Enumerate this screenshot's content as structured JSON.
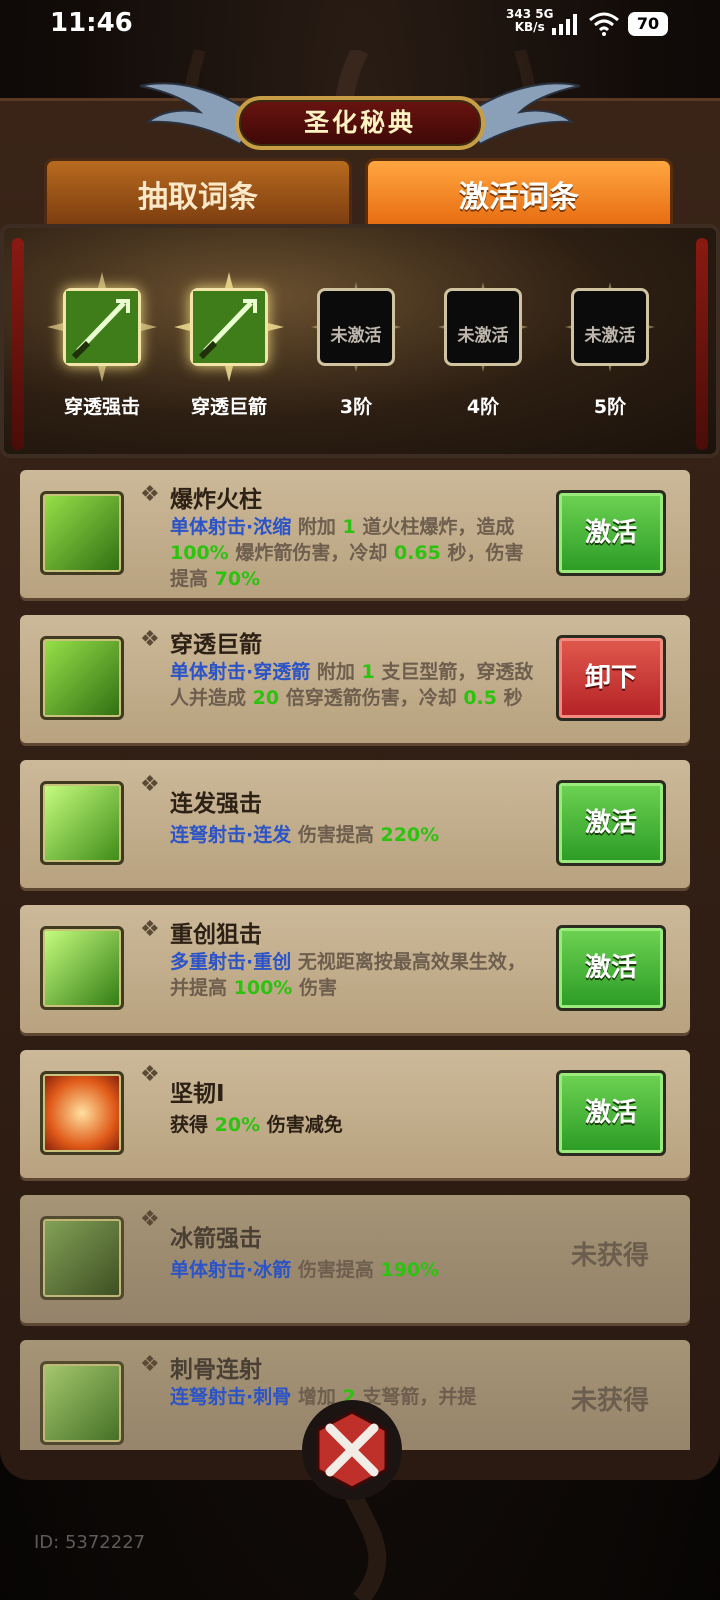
{
  "status_bar": {
    "time": "11:46",
    "net_speed": "343",
    "net_speed_unit": "KB/s",
    "net_type": "5G",
    "battery": "70"
  },
  "header": {
    "title": "圣化秘典"
  },
  "tabs": [
    {
      "label": "抽取词条",
      "active": false
    },
    {
      "label": "激活词条",
      "active": true
    }
  ],
  "slots": [
    {
      "name": "穿透强击",
      "active": true
    },
    {
      "name": "穿透巨箭",
      "active": true
    },
    {
      "name": "3阶",
      "active": false,
      "locked_text": "未激活"
    },
    {
      "name": "4阶",
      "active": false,
      "locked_text": "未激活"
    },
    {
      "name": "5阶",
      "active": false,
      "locked_text": "未激活"
    }
  ],
  "entries": [
    {
      "title": "爆炸火柱",
      "tag": "单体射击·浓缩",
      "desc_parts": [
        "附加 ",
        "1",
        " 道火柱爆炸，造成 ",
        "100%",
        " 爆炸箭伤害，冷却 ",
        "0.65",
        " 秒，伤害提高 ",
        "70%"
      ],
      "button": "激活",
      "button_type": "activate"
    },
    {
      "title": "穿透巨箭",
      "tag": "单体射击·穿透箭",
      "desc_parts": [
        "附加 ",
        "1",
        " 支巨型箭，穿透敌人并造成 ",
        "20",
        " 倍穿透箭伤害，冷却 ",
        "0.5",
        " 秒"
      ],
      "button": "卸下",
      "button_type": "unequip"
    },
    {
      "title": "连发强击",
      "tag": "连弩射击·连发",
      "desc_parts": [
        "伤害提高 ",
        "220%"
      ],
      "button": "激活",
      "button_type": "activate"
    },
    {
      "title": "重创狙击",
      "tag": "多重射击·重创",
      "desc_parts": [
        "无视距离按最高效果生效，并提高 ",
        "100%",
        " 伤害"
      ],
      "button": "激活",
      "button_type": "activate"
    },
    {
      "title": "坚韧Ⅰ",
      "tag": "",
      "desc_parts": [
        "获得 ",
        "20%",
        " 伤害减免"
      ],
      "button": "激活",
      "button_type": "activate"
    },
    {
      "title": "冰箭强击",
      "tag": "单体射击·冰箭",
      "desc_parts": [
        "伤害提高 ",
        "190%"
      ],
      "button": "未获得",
      "button_type": "unavailable"
    },
    {
      "title": "刺骨连射",
      "tag": "连弩射击·刺骨",
      "desc_parts": [
        "增加 ",
        "2",
        " 支弩箭，并提"
      ],
      "button": "未获得",
      "button_type": "unavailable"
    }
  ],
  "footer": {
    "user_id": "ID: 5372227"
  },
  "colors": {
    "accent_green": "#2ec210",
    "tag_blue": "#2c54c6",
    "button_green": "#3aae2e",
    "button_red": "#c42b2b",
    "tab_active": "#f08020"
  }
}
